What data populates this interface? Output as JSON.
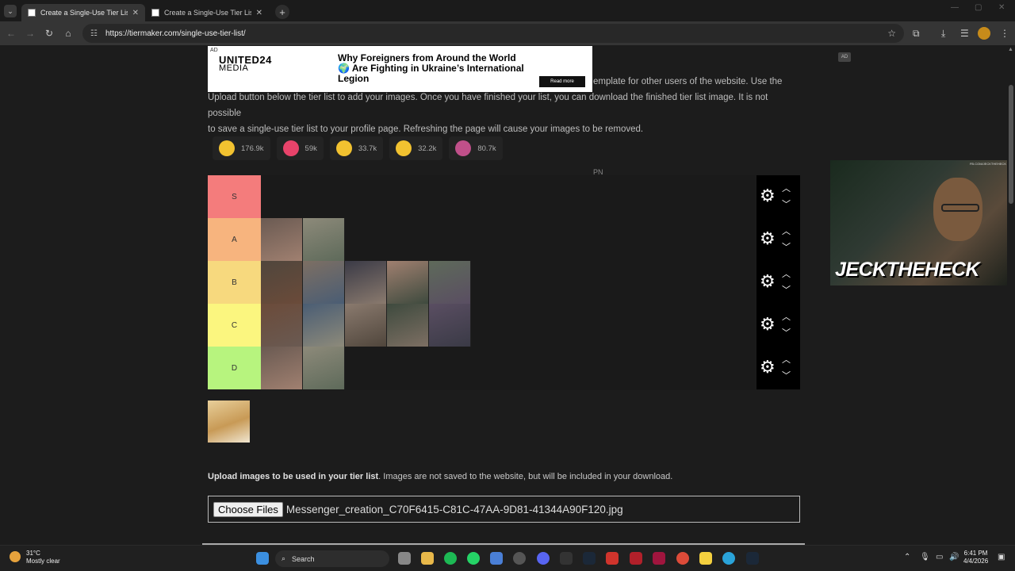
{
  "browser": {
    "tabs": [
      {
        "title": "Create a Single-Use Tier List (P"
      },
      {
        "title": "Create a Single-Use Tier List (P"
      }
    ],
    "url": "https://tiermaker.com/single-use-tier-list/"
  },
  "ad": {
    "tag": "AD",
    "brand_line1": "UNITED24",
    "brand_line2": "MEDIA",
    "headline": "Why Foreigners from Around the World 🌍 Are Fighting in Ukraine’s International Legion",
    "cta": "Read more",
    "badge": "AD"
  },
  "intro": {
    "line1": "emplate for other users of the website. Use the",
    "line2": "Upload button below the tier list to add your images. Once you have finished your list, you can download the finished tier list image. It is not possible",
    "line3": "to save a single-use tier list to your profile page. Refreshing the page will cause your images to be removed."
  },
  "reactions": [
    {
      "icon": "grin-emoji-icon",
      "count": "176.9k",
      "color": "#f2c230"
    },
    {
      "icon": "heart-eyes-emoji-icon",
      "count": "59k",
      "color": "#e8436a"
    },
    {
      "icon": "laughing-emoji-icon",
      "count": "33.7k",
      "color": "#f2c230"
    },
    {
      "icon": "raised-hands-emoji-icon",
      "count": "32.2k",
      "color": "#f2c230"
    },
    {
      "icon": "poop-emoji-icon",
      "count": "80.7k",
      "color": "#c0508a"
    }
  ],
  "pn_label": "PN",
  "tiers": [
    {
      "label": "S",
      "color": "#f47c7c",
      "items": 0
    },
    {
      "label": "A",
      "color": "#f7b47e",
      "items": 2
    },
    {
      "label": "B",
      "color": "#f7d97e",
      "items": 5
    },
    {
      "label": "C",
      "color": "#fbf67f",
      "items": 5
    },
    {
      "label": "D",
      "color": "#b7f47e",
      "items": 2
    }
  ],
  "upload": {
    "bold": "Upload images to be used in your tier list",
    "rest": ". Images are not saved to the website, but will be included in your download.",
    "button": "Choose Files",
    "filename": "Messenger_creation_C70F6415-C81C-47AA-9D81-41344A90F120.jpg"
  },
  "webcam": {
    "caption": "JECKTHEHECK",
    "small": "FB.COM/JECKTHEHECK"
  },
  "taskbar": {
    "weather_temp": "31°C",
    "weather_desc": "Mostly clear",
    "search": "Search",
    "time": "6:41 PM",
    "date": "4/4/2026"
  }
}
